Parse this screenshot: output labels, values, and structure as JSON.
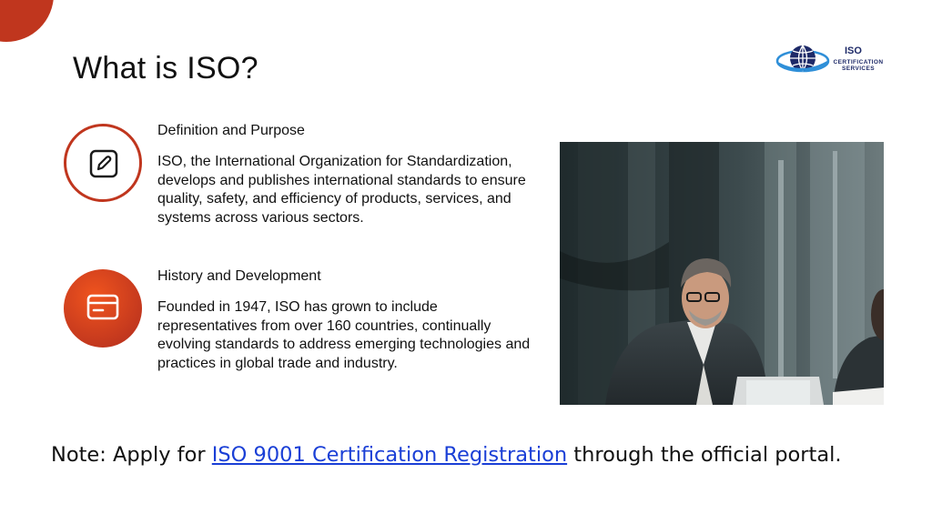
{
  "slide": {
    "title": "What is ISO?"
  },
  "logo": {
    "main_text": "ISO",
    "sub_text": "CERTIFICATION SERVICES",
    "icon": "globe-icon"
  },
  "sections": [
    {
      "heading": "Definition and Purpose",
      "body": "ISO, the International Organization for Standardization, develops and publishes international standards to ensure quality, safety, and efficiency of products, services, and systems across various sectors.",
      "icon": "edit-icon"
    },
    {
      "heading": "History and Development",
      "body": "Founded in 1947, ISO has grown to include representatives from over 160 countries, continually evolving standards to address emerging technologies and practices in global trade and industry.",
      "icon": "card-icon"
    }
  ],
  "photo": {
    "icon": "business-meeting-photo"
  },
  "note": {
    "prefix": "Note: Apply for ",
    "link_text": "ISO 9001 Certification Registration",
    "suffix": " through the official portal."
  },
  "colors": {
    "accent": "#c0361e",
    "accent_light": "#f0541e",
    "link": "#1a3fd6",
    "logo_navy": "#1e2a68"
  }
}
